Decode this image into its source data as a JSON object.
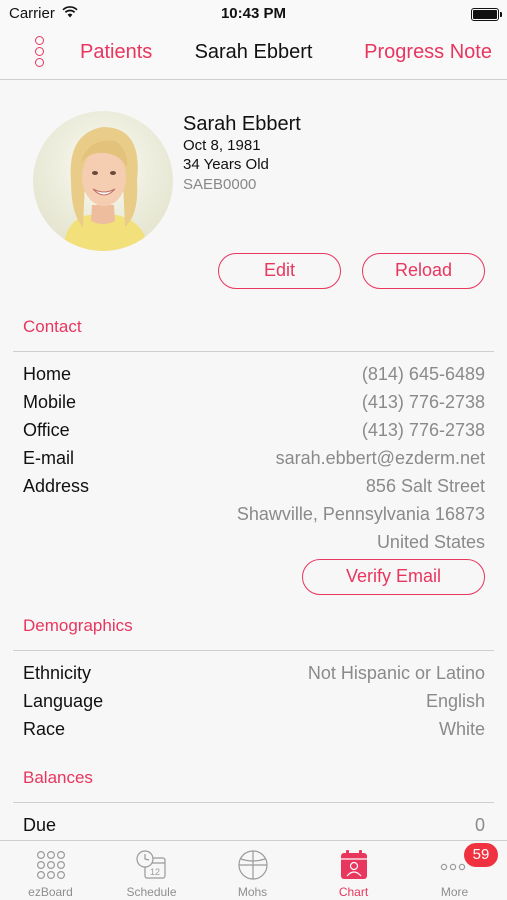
{
  "status_bar": {
    "carrier": "Carrier",
    "time": "10:43 PM"
  },
  "nav": {
    "back_label": "Patients",
    "title": "Sarah Ebbert",
    "right_label": "Progress Note"
  },
  "patient": {
    "name": "Sarah Ebbert",
    "dob": "Oct 8, 1981",
    "age": "34 Years Old",
    "id": "SAEB0000"
  },
  "actions": {
    "edit_label": "Edit",
    "reload_label": "Reload"
  },
  "contact": {
    "header": "Contact",
    "rows": [
      {
        "label": "Home",
        "value": "(814) 645-6489"
      },
      {
        "label": "Mobile",
        "value": "(413) 776-2738"
      },
      {
        "label": "Office",
        "value": "(413) 776-2738"
      },
      {
        "label": "E-mail",
        "value": "sarah.ebbert@ezderm.net"
      },
      {
        "label": "Address",
        "value": "856 Salt Street"
      }
    ],
    "address_line2": "Shawville, Pennsylvania 16873",
    "address_line3": "United States",
    "verify_label": "Verify Email"
  },
  "demographics": {
    "header": "Demographics",
    "rows": [
      {
        "label": "Ethnicity",
        "value": "Not Hispanic or Latino"
      },
      {
        "label": "Language",
        "value": "English"
      },
      {
        "label": "Race",
        "value": "White"
      }
    ]
  },
  "balances": {
    "header": "Balances",
    "rows": [
      {
        "label": "Due",
        "value": "0"
      }
    ]
  },
  "tab_bar": {
    "tabs": [
      {
        "label": "ezBoard",
        "icon": "grid-dots-icon"
      },
      {
        "label": "Schedule",
        "icon": "calendar-clock-icon"
      },
      {
        "label": "Mohs",
        "icon": "mohs-map-icon"
      },
      {
        "label": "Chart",
        "icon": "chart-patient-icon"
      },
      {
        "label": "More",
        "icon": "more-dots-icon"
      }
    ],
    "active": "Chart",
    "calendar_day": "12",
    "more_badge": "59"
  },
  "colors": {
    "accent": "#e8365f",
    "badge": "#f0313f",
    "muted": "#8a8a8a"
  }
}
